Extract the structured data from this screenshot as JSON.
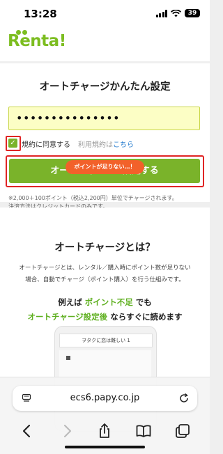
{
  "status_bar": {
    "time": "13:28",
    "battery": "39"
  },
  "app": {
    "logo": "Renta!"
  },
  "autocharge_form": {
    "title": "オートチャージかんたん設定",
    "password_value": "•••••••••••••••",
    "agree_label": "規約に同意する",
    "terms_prefix": "利用規約は",
    "terms_link": "こちら",
    "button_label": "オートチャージを設定する",
    "note_line1": "※2,000＋100ポイント（税込2,200円）単位でチャージされます。",
    "note_line2": "決済方法はクレジットカードのみです。"
  },
  "about": {
    "title": "オートチャージとは？",
    "desc_line1": "オートチャージとは、レンタル／購入時にポイント数が足りない",
    "desc_line2": "場合、自動でチャージ（ポイント購入）を行う仕組みです。",
    "example_prefix": "例えば",
    "example_highlight": "ポイント不足",
    "example_suffix": "でも",
    "example_line2_highlight": "オートチャージ設定後",
    "example_line2_suffix": "ならすぐに読めます",
    "phone_title": "ヲタクに恋は難しい 1",
    "bubble_text": "ポイントが足りない…！"
  },
  "browser": {
    "url": "ecs6.papy.co.jp"
  },
  "colors": {
    "brand_green": "#7ab32a",
    "highlight_red": "#e02424",
    "bubble_orange": "#f2612a"
  }
}
